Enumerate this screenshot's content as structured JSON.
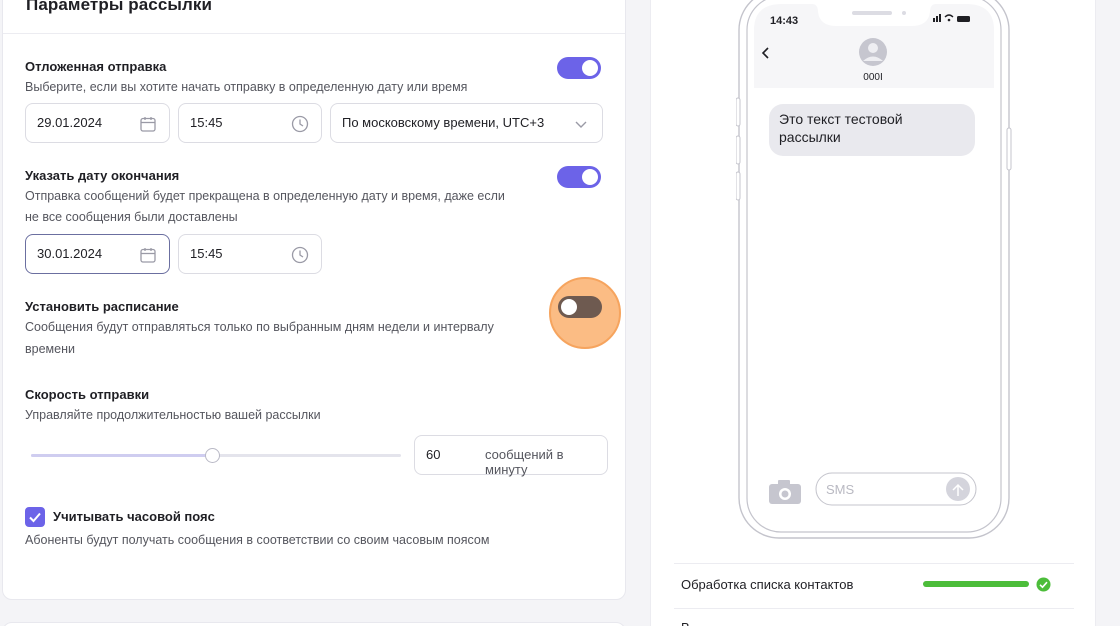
{
  "section_title": "Параметры рассылки",
  "delayed": {
    "title": "Отложенная отправка",
    "desc": "Выберите, если вы хотите начать отправку в определенную дату или время",
    "enabled": true,
    "date": "29.01.2024",
    "time": "15:45",
    "timezone": "По московскому времени, UTC+3"
  },
  "end_date": {
    "title": "Указать дату окончания",
    "desc_line1": "Отправка сообщений будет прекращена в определенную дату и время, даже если",
    "desc_line2": "не все сообщения были доставлены",
    "enabled": true,
    "date": "30.01.2024",
    "time": "15:45"
  },
  "schedule": {
    "title": "Установить расписание",
    "desc_line1": "Сообщения будут отправляться только по выбранным дням недели и интервалу",
    "desc_line2": "времени",
    "enabled": false
  },
  "speed": {
    "title": "Скорость отправки",
    "desc": "Управляйте продолжительностью вашей рассылки",
    "value": "60",
    "unit": "сообщений в минуту",
    "slider_fraction": 0.49
  },
  "timezone_option": {
    "label": "Учитывать часовой пояс",
    "desc": "Абоненты будут получать сообщения в соответствии со своим часовым поясом",
    "checked": true
  },
  "phone": {
    "time": "14:43",
    "sender": "000I",
    "message_line1": "Это текст тестовой",
    "message_line2": "рассылки",
    "input_placeholder": "SMS"
  },
  "status": {
    "row1_label": "Обработка списка контактов",
    "row1_progress": 1.0,
    "row2_label": "В"
  },
  "colors": {
    "accent": "#6c63e8",
    "toggle_off": "#6e5a50",
    "highlight": "#fab06e",
    "success": "#4cbd3a"
  }
}
